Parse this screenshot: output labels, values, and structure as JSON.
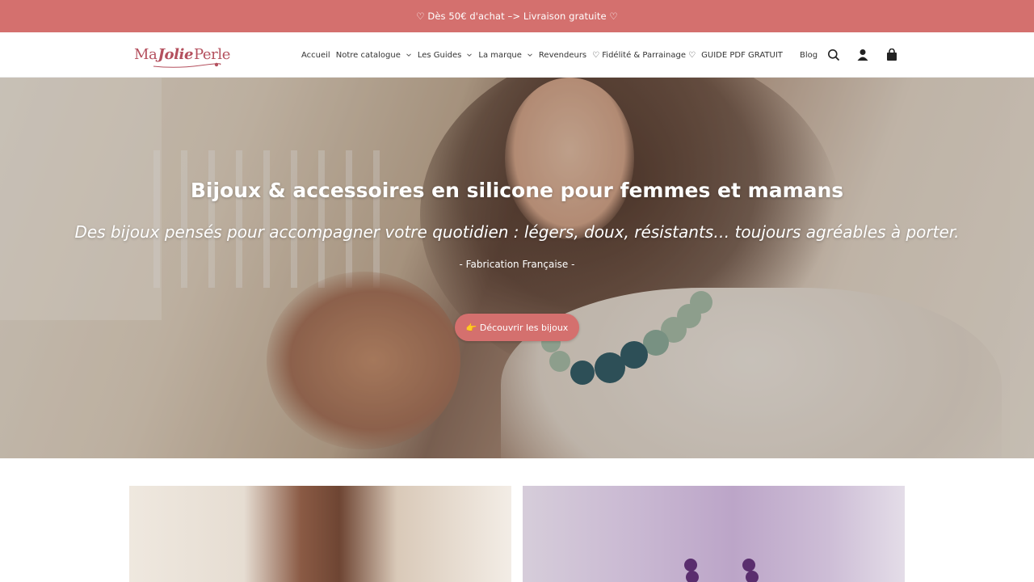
{
  "announcement": "♡ Dès 50€ d'achat –> Livraison gratuite ♡",
  "logo": {
    "ma": "Ma",
    "jolie": "Jolie",
    "perle": "Perle"
  },
  "nav": {
    "items": [
      {
        "label": "Accueil",
        "dropdown": false
      },
      {
        "label": "Notre catalogue",
        "dropdown": true
      },
      {
        "label": "Les Guides",
        "dropdown": true
      },
      {
        "label": "La marque",
        "dropdown": true
      },
      {
        "label": "Revendeurs",
        "dropdown": false
      },
      {
        "label": "♡ Fidélité & Parrainage ♡",
        "dropdown": false
      },
      {
        "label": "GUIDE PDF GRATUIT",
        "dropdown": false
      }
    ]
  },
  "tools": {
    "blog_label": "Blog",
    "icons": [
      "search-icon",
      "account-icon",
      "cart-icon"
    ]
  },
  "hero": {
    "title": "Bijoux & accessoires en silicone pour femmes et mamans",
    "subtitle": "Des bijoux pensés pour accompagner votre quotidien : légers, doux, résistants… toujours agréables à porter.",
    "tagline": "- Fabrication Française -",
    "cta_label": "👉 Découvrir les bijoux"
  },
  "colors": {
    "accent": "#d4706e",
    "brand": "#b4505e"
  }
}
